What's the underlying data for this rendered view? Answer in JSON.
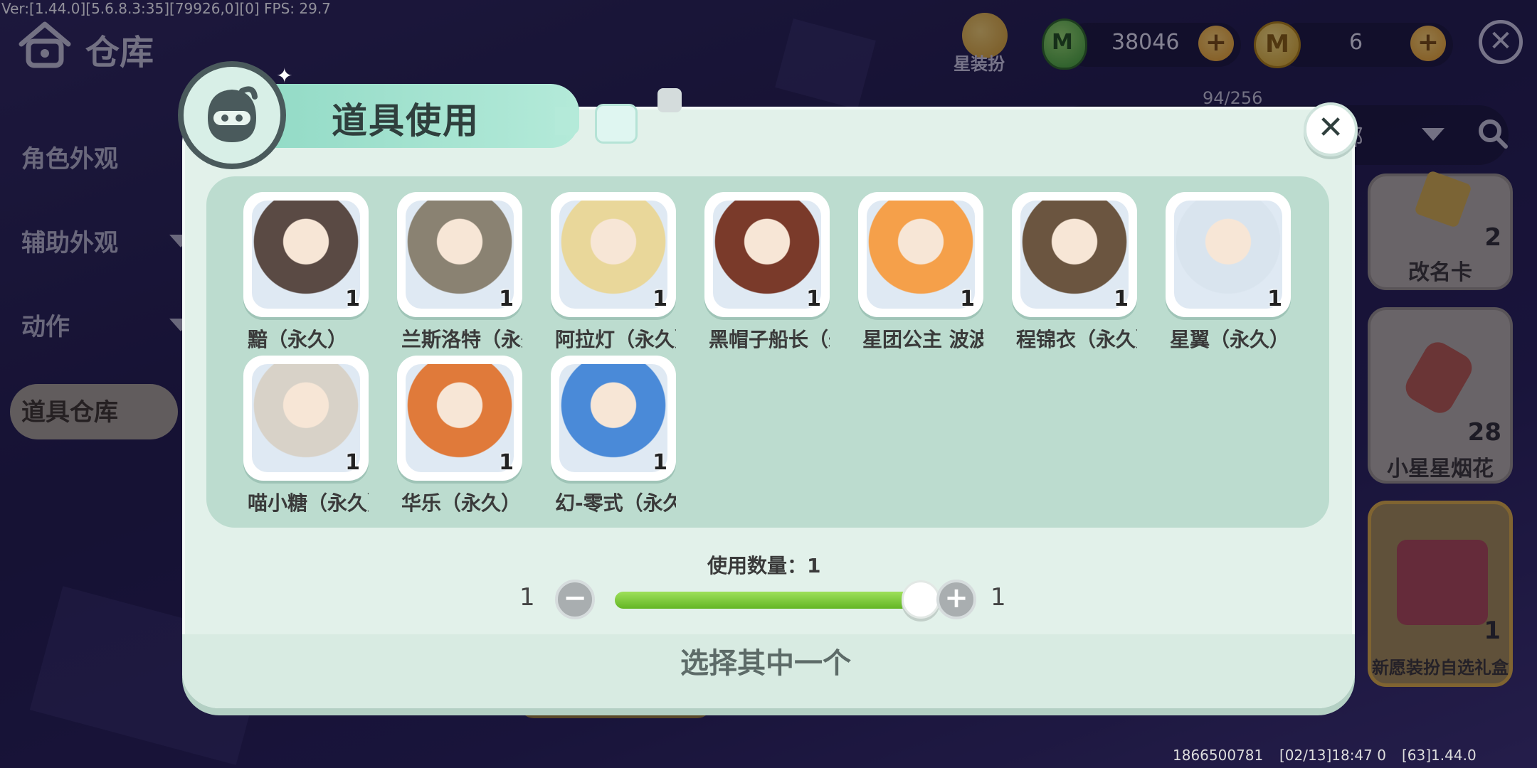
{
  "debug": {
    "version": "Ver:[1.44.0][5.6.8.3:35][79926,0][0] FPS: 29.7",
    "bottom_id": "1866500781",
    "bottom_time": "[02/13]18:47 0",
    "bottom_ver": "[63]1.44.0"
  },
  "header": {
    "title": "仓库",
    "home_icon": "home-icon"
  },
  "sidebar": {
    "items": [
      {
        "label": "角色外观",
        "has_dropdown": false
      },
      {
        "label": "辅助外观",
        "has_dropdown": true
      },
      {
        "label": "动作",
        "has_dropdown": true
      },
      {
        "label": "道具仓库",
        "active": true
      }
    ]
  },
  "currency": {
    "costume_label": "星装扮",
    "mini_beans": "38046",
    "mini_coins": "6",
    "egg_letter": "M",
    "coin_letter": "M",
    "plus": "+",
    "close": "✕"
  },
  "inventory": {
    "capacity": "94/256",
    "filter_text": "部",
    "right_cards": [
      {
        "name": "改名卡",
        "count": "2"
      },
      {
        "name": "小星星烟花",
        "count": "28"
      },
      {
        "name": "新愿装扮自选礼盒",
        "count": "1",
        "selected": true
      }
    ]
  },
  "modal": {
    "title": "道具使用",
    "close": "✕",
    "items": [
      {
        "name": "黯（永久）",
        "count": "1",
        "color": "#5a4a44"
      },
      {
        "name": "兰斯洛特（永久）",
        "count": "1",
        "color": "#8a8272"
      },
      {
        "name": "阿拉灯（永久）",
        "count": "1",
        "color": "#e9d79a"
      },
      {
        "name": "黑帽子船长（永久）",
        "count": "1",
        "color": "#7a3a2a"
      },
      {
        "name": "星团公主 波波（永久）",
        "count": "1",
        "color": "#f5a04a"
      },
      {
        "name": "程锦衣（永久）",
        "count": "1",
        "color": "#6b5540"
      },
      {
        "name": "星翼（永久）",
        "count": "1",
        "color": "#d9e4ee"
      },
      {
        "name": "喵小糖（永久）",
        "count": "1",
        "color": "#d8d2c8"
      },
      {
        "name": "华乐（永久）",
        "count": "1",
        "color": "#e07a3a"
      },
      {
        "name": "幻-零式（永久）",
        "count": "1",
        "color": "#4a8ad8"
      }
    ],
    "quantity_label": "使用数量：1",
    "quantity_min": "1",
    "quantity_max": "1",
    "quantity_value": 1,
    "minus": "−",
    "plus": "+",
    "hint": "选择其中一个"
  }
}
